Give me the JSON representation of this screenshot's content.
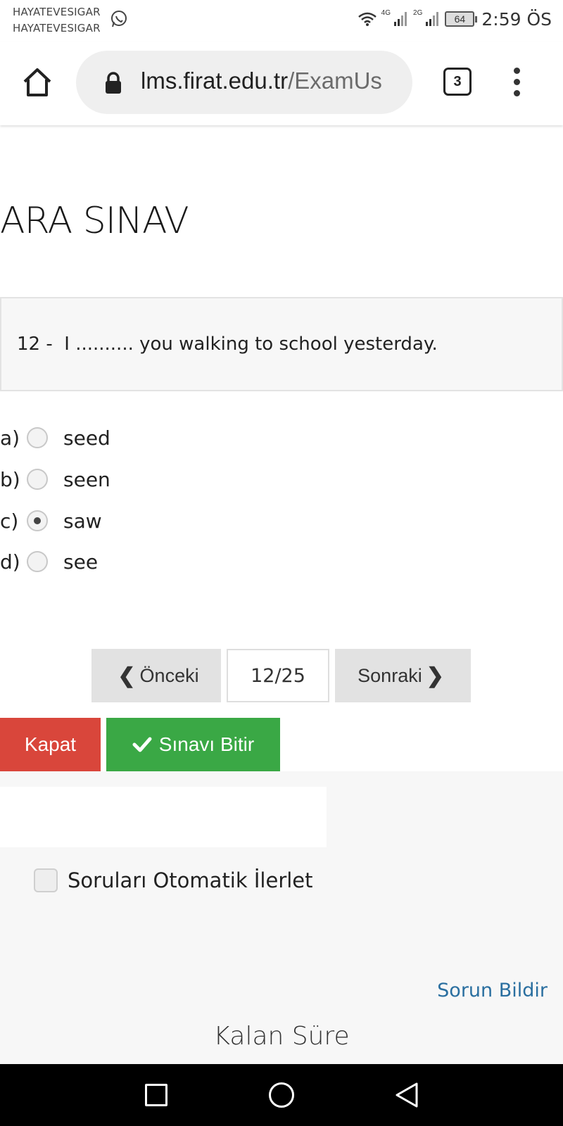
{
  "status_bar": {
    "notification_line_1": "HAYATEVESIGAR",
    "notification_line_2": "HAYATEVESIGAR",
    "network_1": "4G",
    "network_2": "2G",
    "battery": "64",
    "time": "2:59 ÖS"
  },
  "browser": {
    "url_host": "lms.firat.edu.tr",
    "url_path": "/ExamUs",
    "tab_count": "3"
  },
  "page": {
    "title": "ARA SINAV"
  },
  "question": {
    "number": "12 -",
    "text": "I .......... you walking to school yesterday."
  },
  "options": [
    {
      "letter": "a)",
      "text": "seed",
      "selected": false
    },
    {
      "letter": "b)",
      "text": "seen",
      "selected": false
    },
    {
      "letter": "c)",
      "text": "saw",
      "selected": true
    },
    {
      "letter": "d)",
      "text": "see",
      "selected": false
    }
  ],
  "pager": {
    "prev_label": "Önceki",
    "current": "12/25",
    "next_label": "Sonraki"
  },
  "actions": {
    "close_label": "Kapat",
    "finish_label": "Sınavı Bitir"
  },
  "settings": {
    "auto_advance_label": "Soruları Otomatik İlerlet",
    "auto_advance_checked": false
  },
  "footer": {
    "report_label": "Sorun Bildir",
    "remaining_time_label": "Kalan Süre"
  }
}
